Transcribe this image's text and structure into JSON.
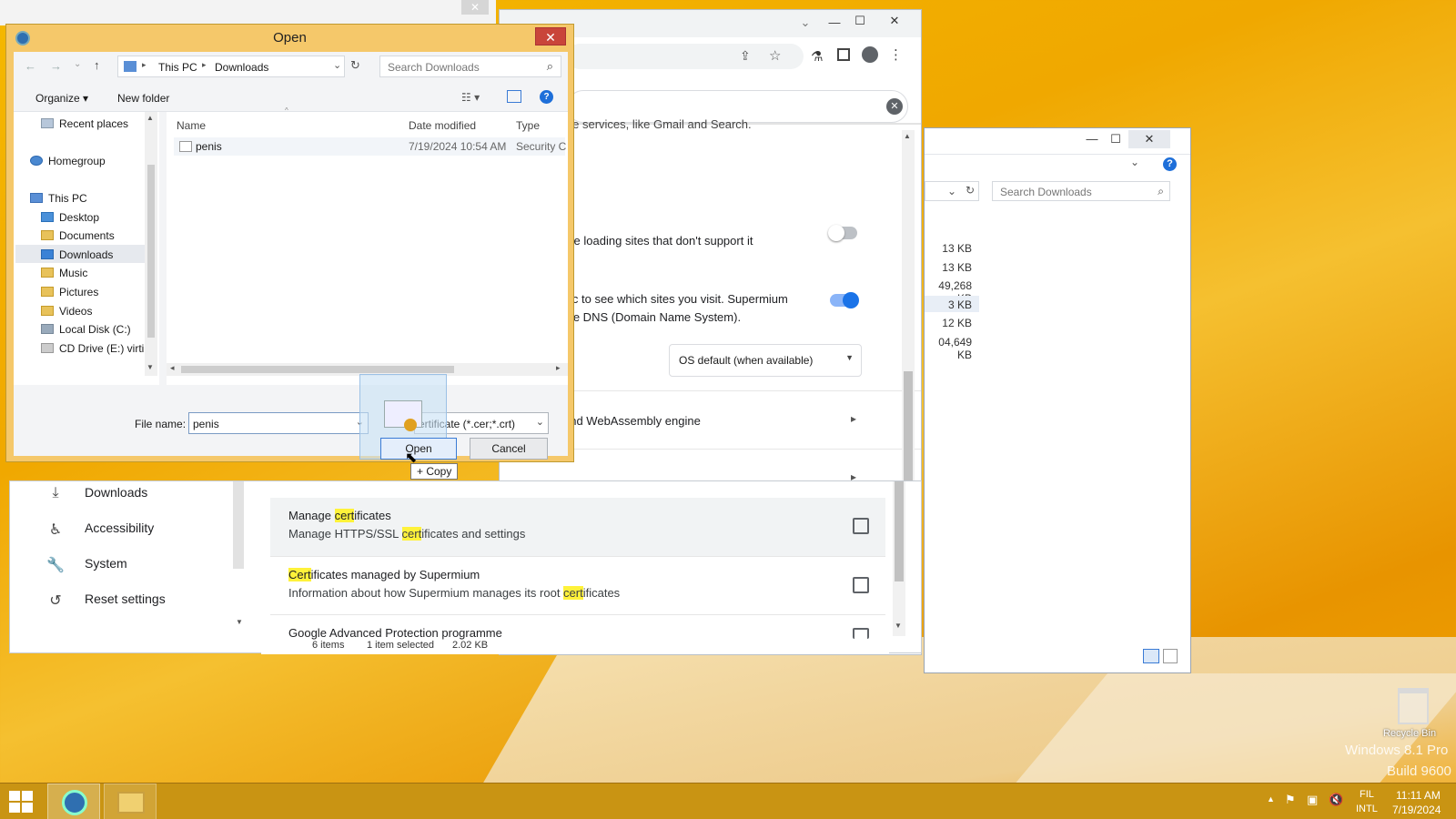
{
  "dialog": {
    "title": "Open",
    "close_label": "✕",
    "breadcrumb": [
      "This PC",
      "Downloads"
    ],
    "search_placeholder": "Search Downloads",
    "organize_label": "Organize",
    "new_folder_label": "New folder",
    "nav_items": [
      "Recent places",
      "Homegroup",
      "This PC",
      "Desktop",
      "Documents",
      "Downloads",
      "Music",
      "Pictures",
      "Videos",
      "Local Disk (C:)",
      "CD Drive (E:) virti"
    ],
    "columns": [
      "Name",
      "Date modified",
      "Type"
    ],
    "files": [
      {
        "name": "penis",
        "date": "7/19/2024 10:54 AM",
        "type": "Security C"
      }
    ],
    "file_name_label": "File name:",
    "file_name_value": "penis",
    "filter_value": "ertificate (*.cer;*.crt)",
    "open_label": "Open",
    "cancel_label": "Cancel",
    "drag_tooltip": "+ Copy"
  },
  "browser": {
    "row_texts": {
      "services": "gle services, like Gmail and Search.",
      "https_first": "ore loading sites that don't support it",
      "dns_line1": "ffic to see which sites you visit. Supermium",
      "dns_line2": "the DNS (Domain Name System).",
      "dns_select": "OS default (when available)",
      "v8": "and WebAssembly engine"
    },
    "toggle_off": false,
    "toggle_on": true,
    "accent": "#1a73e8"
  },
  "settings": {
    "sidebar": [
      {
        "icon": "download-icon",
        "label": "Downloads"
      },
      {
        "icon": "accessibility-icon",
        "label": "Accessibility"
      },
      {
        "icon": "wrench-icon",
        "label": "System"
      },
      {
        "icon": "reset-icon",
        "label": "Reset settings"
      }
    ],
    "rows": [
      {
        "title_pre": "Manage ",
        "title_hl": "cert",
        "title_post": "ificates",
        "desc_pre": "Manage HTTPS/SSL ",
        "desc_hl": "cert",
        "desc_post": "ificates and settings"
      },
      {
        "title_pre": "",
        "title_hl": "Cert",
        "title_post": "ificates managed by Supermium",
        "desc_pre": "Information about how Supermium manages its root ",
        "desc_hl": "cert",
        "desc_post": "ificates"
      },
      {
        "title_pre": "Google Advanced Protection programme",
        "title_hl": "",
        "title_post": "",
        "desc_pre": "",
        "desc_hl": "",
        "desc_post": ""
      }
    ],
    "status_bar": {
      "items": "6 items",
      "selected": "1 item selected",
      "size": "2.02 KB"
    }
  },
  "explorer": {
    "search_placeholder": "Search Downloads",
    "sizes": [
      "13 KB",
      "13 KB",
      "49,268 KB",
      "3 KB",
      "12 KB",
      "04,649 KB"
    ]
  },
  "desktop": {
    "recycle_bin": "Recycle Bin",
    "watermark1": "Windows 8.1 Pro",
    "watermark2": "Build 9600"
  },
  "taskbar": {
    "lang1": "FIL",
    "lang2": "INTL",
    "time": "11:11 AM",
    "date": "7/19/2024"
  }
}
